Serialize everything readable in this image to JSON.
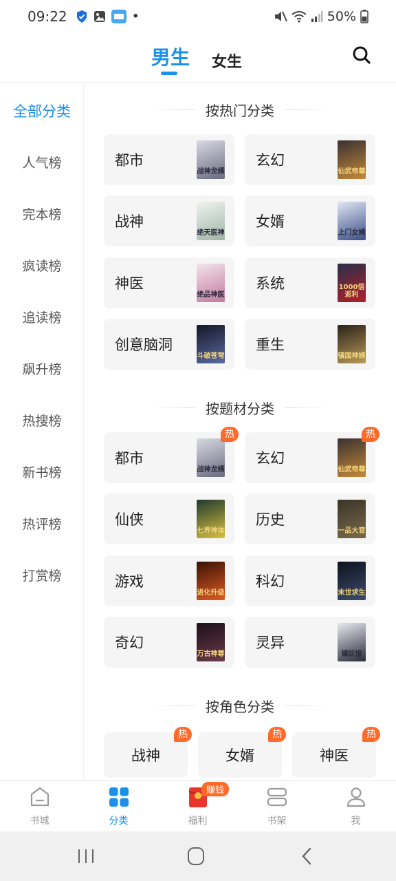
{
  "status_bar": {
    "time": "09:22",
    "battery": "50%",
    "dot": "•"
  },
  "header": {
    "tab_male": "男生",
    "tab_female": "女生"
  },
  "sidebar": {
    "items": [
      {
        "label": "全部分类"
      },
      {
        "label": "人气榜"
      },
      {
        "label": "完本榜"
      },
      {
        "label": "疯读榜"
      },
      {
        "label": "追读榜"
      },
      {
        "label": "飙升榜"
      },
      {
        "label": "热搜榜"
      },
      {
        "label": "新书榜"
      },
      {
        "label": "热评榜"
      },
      {
        "label": "打赏榜"
      }
    ]
  },
  "sections": {
    "hot": {
      "title": "按热门分类",
      "items": [
        {
          "label": "都市",
          "cover": "战神龙婿",
          "cover_colors": [
            "#d9d9e3",
            "#6a6a80"
          ]
        },
        {
          "label": "玄幻",
          "cover": "仙武帝尊",
          "cover_colors": [
            "#3a3030",
            "#c48a3a"
          ]
        },
        {
          "label": "战神",
          "cover": "绝天医神",
          "cover_colors": [
            "#eef3ee",
            "#9fb6a8"
          ]
        },
        {
          "label": "女婿",
          "cover": "上门女婿",
          "cover_colors": [
            "#dfe6f3",
            "#3b4e88"
          ]
        },
        {
          "label": "神医",
          "cover": "绝品神医",
          "cover_colors": [
            "#f3e3ea",
            "#c07aa0"
          ]
        },
        {
          "label": "系统",
          "cover": "1000倍返利",
          "cover_colors": [
            "#2a2f4a",
            "#b0202a"
          ]
        },
        {
          "label": "创意脑洞",
          "cover": "斗破苍穹",
          "cover_colors": [
            "#141726",
            "#5a6aa0"
          ]
        },
        {
          "label": "重生",
          "cover": "镇国神婿",
          "cover_colors": [
            "#2a2218",
            "#b89a5a"
          ]
        }
      ]
    },
    "theme": {
      "title": "按题材分类",
      "hot_badge": "热",
      "items": [
        {
          "label": "都市",
          "cover": "战神龙婿",
          "cover_colors": [
            "#d9d9e3",
            "#6a6a80"
          ],
          "hot": true
        },
        {
          "label": "玄幻",
          "cover": "仙武帝尊",
          "cover_colors": [
            "#3a3030",
            "#c48a3a"
          ],
          "hot": true
        },
        {
          "label": "仙侠",
          "cover": "七界神体",
          "cover_colors": [
            "#1f3a2e",
            "#d8c040"
          ],
          "hot": false
        },
        {
          "label": "历史",
          "cover": "一品大官",
          "cover_colors": [
            "#3a3428",
            "#7a6a4a"
          ],
          "hot": false
        },
        {
          "label": "游戏",
          "cover": "进化升级",
          "cover_colors": [
            "#3a1208",
            "#e05a20"
          ],
          "hot": false
        },
        {
          "label": "科幻",
          "cover": "末世求生",
          "cover_colors": [
            "#0e1420",
            "#3a4a6a"
          ],
          "hot": false
        },
        {
          "label": "奇幻",
          "cover": "万古神尊",
          "cover_colors": [
            "#1c1018",
            "#6a3a4a"
          ],
          "hot": false
        },
        {
          "label": "灵异",
          "cover": "镇妖馆",
          "cover_colors": [
            "#e8eaf0",
            "#2a2a3a"
          ],
          "hot": false
        }
      ]
    },
    "role": {
      "title": "按角色分类",
      "hot_badge": "热",
      "items": [
        {
          "label": "战神",
          "hot": true
        },
        {
          "label": "女婿",
          "hot": true
        },
        {
          "label": "神医",
          "hot": true
        }
      ]
    }
  },
  "bottom_nav": {
    "items": [
      {
        "label": "书城"
      },
      {
        "label": "分类"
      },
      {
        "label": "福利",
        "badge": "赚钱"
      },
      {
        "label": "书架"
      },
      {
        "label": "我"
      }
    ]
  },
  "colors": {
    "accent": "#1a90e8",
    "hot": "#ff6a2a",
    "card_bg": "#f5f5f5"
  }
}
